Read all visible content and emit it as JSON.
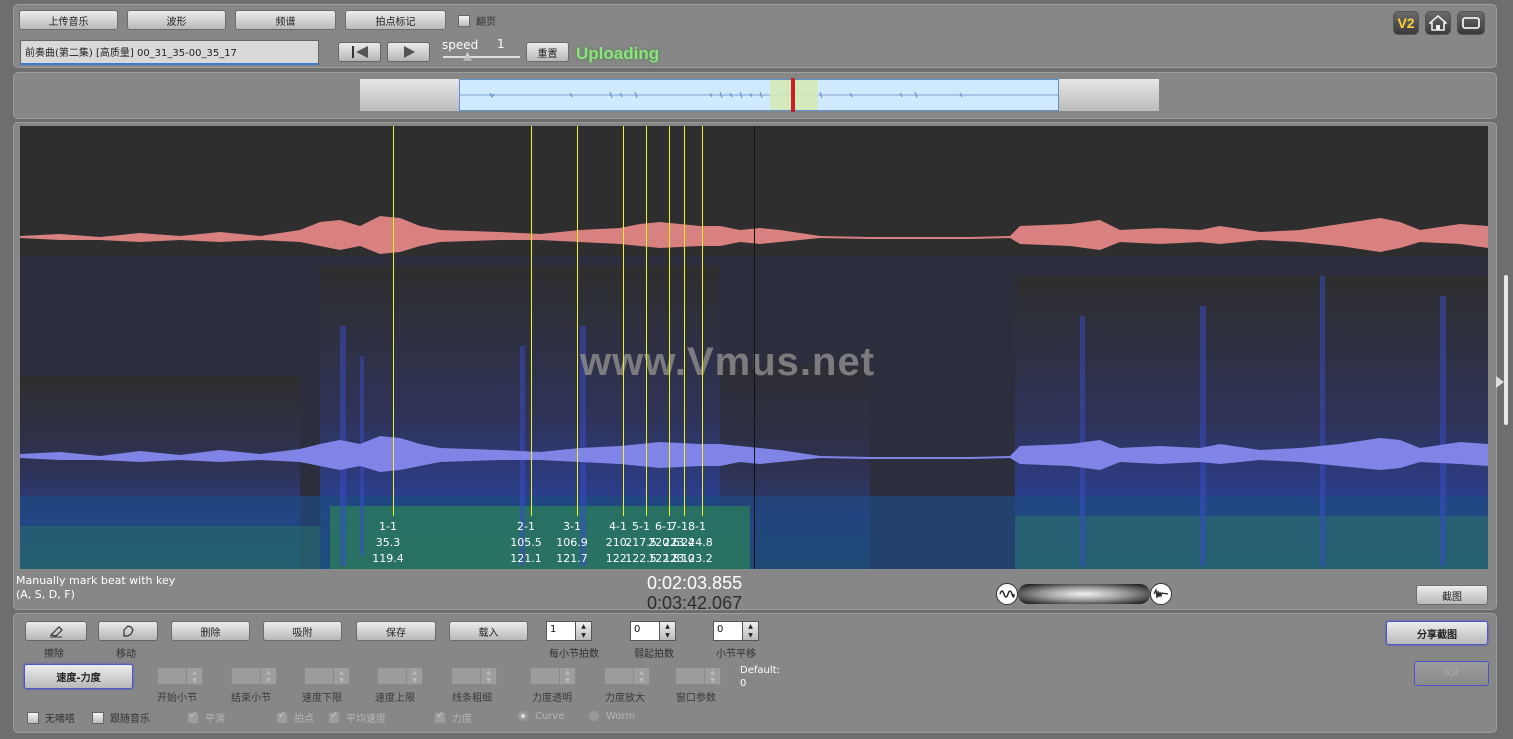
{
  "toolbar": {
    "upload_music": "上传音乐",
    "waveform": "波形",
    "spectrum": "频谱",
    "beat_mark": "拍点标记",
    "flip_page": "翻页"
  },
  "file": {
    "name": "前奏曲(第二集) [高质量] 00_31_35-00_35_17"
  },
  "playback": {
    "speed_label": "speed",
    "speed_value": "1",
    "reset": "重置",
    "status": "Uploading"
  },
  "top_right": {
    "v2": "V2"
  },
  "watermark": "www.Vmus.net",
  "beats": [
    {
      "label": "1-1",
      "v1": "35.3",
      "v2": "119.4"
    },
    {
      "label": "2-1",
      "v1": "105.5",
      "v2": "121.1"
    },
    {
      "label": "3-1",
      "v1": "106.9",
      "v2": "121.7"
    },
    {
      "label": "4-1",
      "v1": "210.",
      "v2": "122."
    },
    {
      "label": "5-1",
      "v1": "217.5",
      "v2": "122.5"
    },
    {
      "label": "6-1",
      "v1": "220.6",
      "v2": "122.8"
    },
    {
      "label": "7-1",
      "v1": "223.4",
      "v2": "123.0"
    },
    {
      "label": "8-1",
      "v1": "224.8",
      "v2": "123.2"
    }
  ],
  "hint": {
    "line1": "Manually mark beat with key",
    "line2": "(A, S, D, F)"
  },
  "time": {
    "current": "0:02:03.855",
    "total": "0:03:42.067"
  },
  "screenshot_button": "截图",
  "tools": {
    "erase": "擦除",
    "move": "移动",
    "delete": "删除",
    "snap": "吸附",
    "save": "保存",
    "load": "载入",
    "beats_per_bar": {
      "label": "每小节拍数",
      "value": "1"
    },
    "pickup_beats": {
      "label": "弱起拍数",
      "value": "0"
    },
    "bar_shift": {
      "label": "小节平移",
      "value": "0"
    },
    "share_screenshot": "分享截图",
    "speed_force": "速度-力度",
    "ioi": "IOI",
    "start_bar": "开始小节",
    "end_bar": "结束小节",
    "speed_lower": "速度下限",
    "speed_upper": "速度上限",
    "line_width": "线条粗细",
    "force_alpha": "力度透明",
    "force_zoom": "力度放大",
    "window_param": "窗口参数",
    "default_label": "Default:",
    "default_value": "0",
    "no_beat": "无嘀嗒",
    "follow_music": "跟随音乐",
    "smooth": "平滑",
    "beat_point": "拍点",
    "avg_speed": "平均速度",
    "force": "力度",
    "curve": "Curve",
    "worm": "Worm"
  },
  "colors": {
    "accent_green": "#7fe07a",
    "beat_line": "#f0f020",
    "wave_top": "#d98080",
    "wave_bottom": "#7f84e6",
    "spectrogram_bg": "#2e2e2e"
  }
}
